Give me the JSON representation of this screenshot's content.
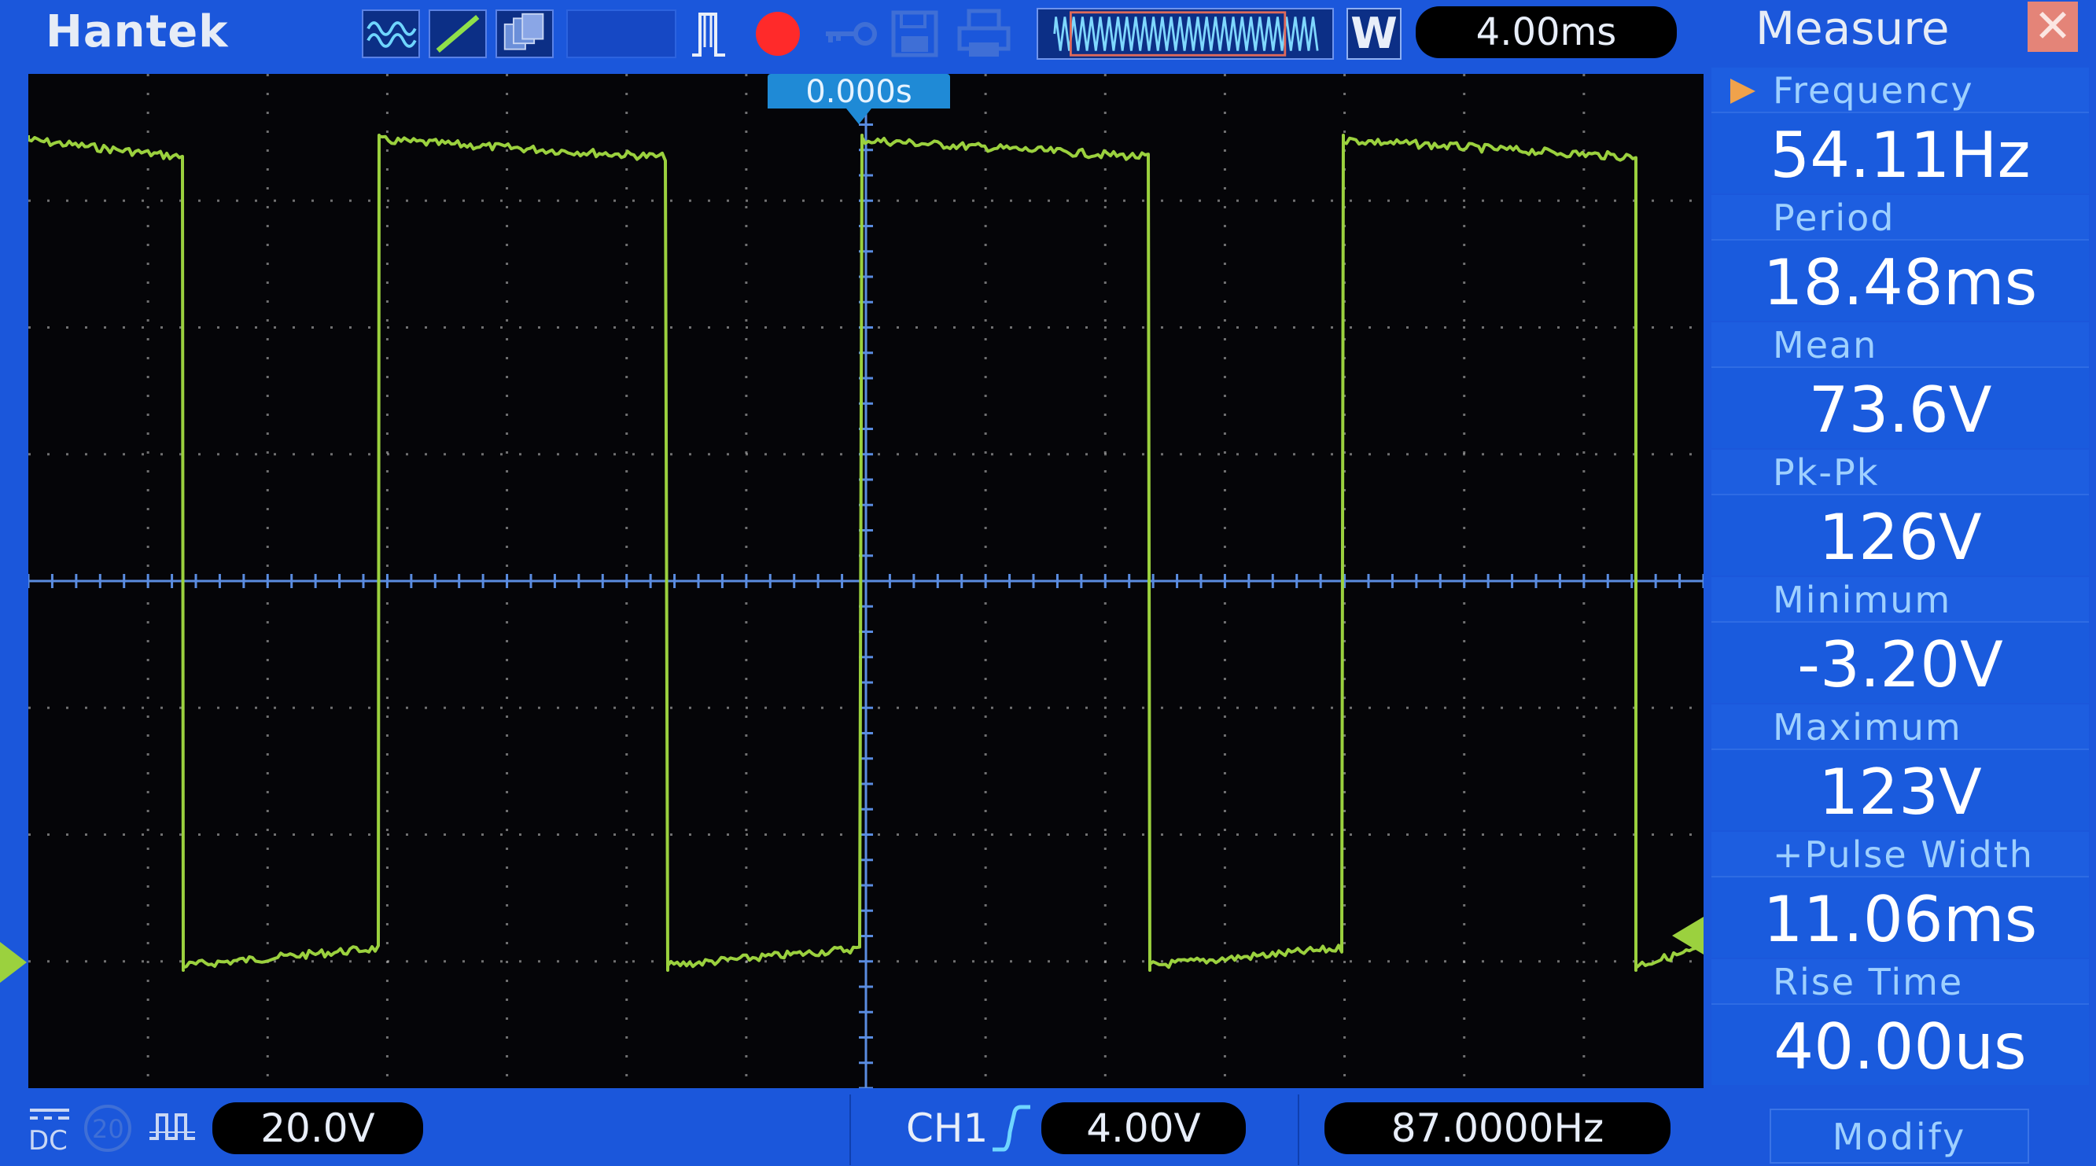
{
  "brand": "Hantek",
  "toolbar": {
    "timebase": "4.00ms",
    "memory_window_badge": "W",
    "icons": [
      "waveform-icon",
      "trigger-slope-icon",
      "persistence-icon",
      "single-trigger-icon",
      "run-stop-icon",
      "key-icon",
      "save-icon",
      "print-icon",
      "memory-window-icon"
    ]
  },
  "screen": {
    "trigger_time": "0.000s",
    "trace_color": "#9bd13e",
    "grid_color": "#c8c8c8",
    "axis_color": "#5a8ce0"
  },
  "measure": {
    "title": "Measure",
    "items": [
      {
        "label": "Frequency",
        "value": "54.11Hz"
      },
      {
        "label": "Period",
        "value": "18.48ms"
      },
      {
        "label": "Mean",
        "value": "73.6V"
      },
      {
        "label": "Pk-Pk",
        "value": "126V"
      },
      {
        "label": "Minimum",
        "value": "-3.20V"
      },
      {
        "label": "Maximum",
        "value": "123V"
      },
      {
        "label": "+Pulse Width",
        "value": "11.06ms"
      },
      {
        "label": "Rise Time",
        "value": "40.00us"
      }
    ],
    "modify_label": "Modify"
  },
  "bottom": {
    "coupling": "DC",
    "bandwidth_limit_label": "20",
    "volts_per_div": "20.0V",
    "trigger_channel": "CH1",
    "trigger_level": "4.00V",
    "trigger_frequency": "87.0000Hz"
  }
}
